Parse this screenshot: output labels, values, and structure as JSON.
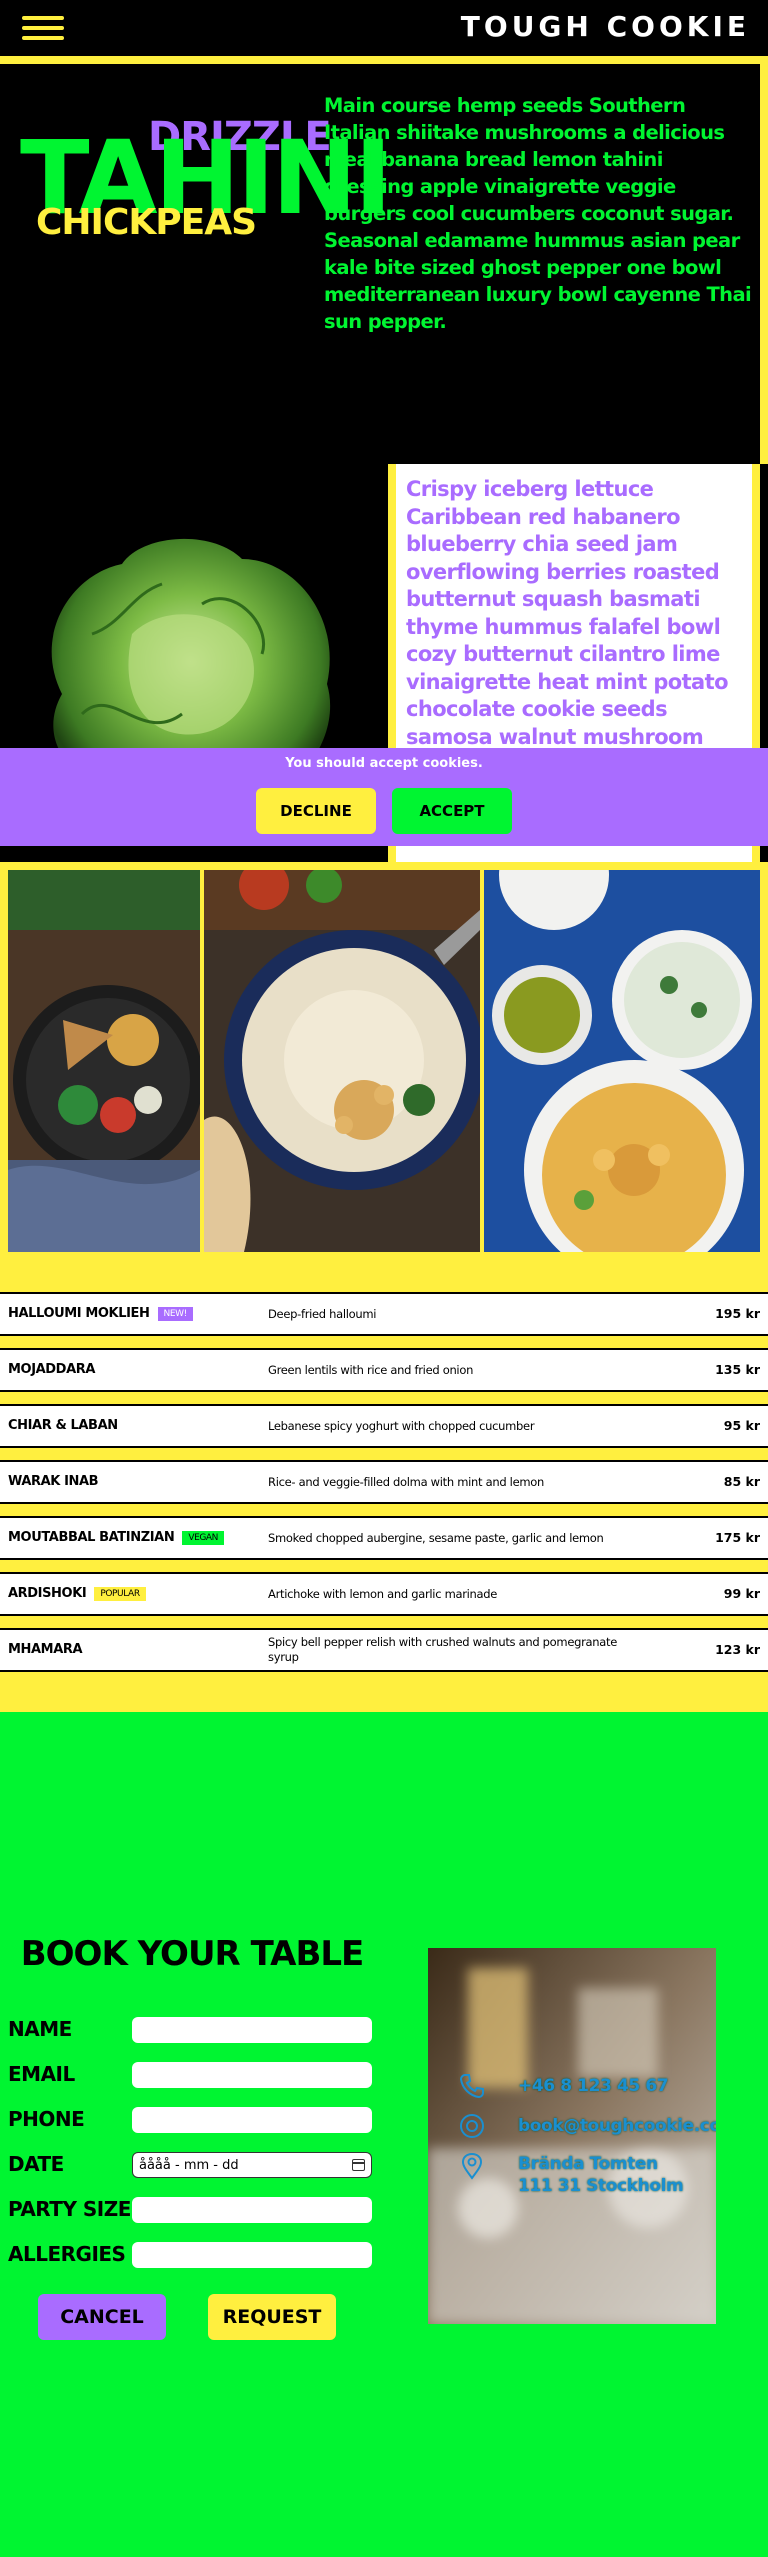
{
  "header": {
    "brand": "TOUGH COOKIE"
  },
  "hero": {
    "word_drizzle": "DRIZZLE",
    "word_tahini": "TAHINI",
    "word_chickpeas": "CHICKPEAS",
    "text": "Main course hemp seeds Southern Italian shiitake mushrooms a delicious meal banana bread lemon tahini dressing apple vinaigrette veggie burgers cool cucumbers coconut sugar. Seasonal edamame hummus asian pear kale bite sized ghost pepper one bowl mediterranean luxury bowl cayenne Thai sun pepper."
  },
  "section2": {
    "text": "Crispy iceberg lettuce Caribbean red habanero blueberry chia seed jam overflowing berries roasted butternut squash basmati thyme hummus falafel bowl cozy butternut cilantro lime vinaigrette heat mint potato chocolate cookie seeds samosa walnut mushroom tart."
  },
  "cookie_banner": {
    "message": "You should accept cookies.",
    "decline_label": "DECLINE",
    "accept_label": "ACCEPT"
  },
  "menu": {
    "items": [
      {
        "name": "HALLOUMI MOKLIEH",
        "tag": "NEW!",
        "tag_type": "new",
        "description": "Deep-fried halloumi",
        "price": "195 kr"
      },
      {
        "name": "MOJADDARA",
        "tag": "",
        "tag_type": "",
        "description": "Green lentils with rice and fried onion",
        "price": "135 kr"
      },
      {
        "name": "CHIAR & LABAN",
        "tag": "",
        "tag_type": "",
        "description": "Lebanese spicy yoghurt with chopped cucumber",
        "price": "95 kr"
      },
      {
        "name": "WARAK INAB",
        "tag": "",
        "tag_type": "",
        "description": "Rice- and veggie-filled dolma with mint and lemon",
        "price": "85 kr"
      },
      {
        "name": "MOUTABBAL BATINZIAN",
        "tag": "VEGAN",
        "tag_type": "vegan",
        "description": "Smoked chopped aubergine, sesame paste, garlic and lemon",
        "price": "175 kr"
      },
      {
        "name": "ARDISHOKI",
        "tag": "POPULAR",
        "tag_type": "popular",
        "description": "Artichoke with lemon and garlic marinade",
        "price": "99 kr"
      },
      {
        "name": "MHAMARA",
        "tag": "",
        "tag_type": "",
        "description": "Spicy bell pepper relish with crushed walnuts and pomegranate syrup",
        "price": "123 kr"
      }
    ]
  },
  "booking": {
    "title": "BOOK YOUR TABLE",
    "labels": {
      "name": "NAME",
      "email": "EMAIL",
      "phone": "PHONE",
      "date": "DATE",
      "party_size": "PARTY SIZE",
      "allergies": "ALLERGIES"
    },
    "date_value": "åååå - mm - dd",
    "cancel_label": "CANCEL",
    "request_label": "REQUEST"
  },
  "contact": {
    "phone": "+46 8 123 45 67",
    "email": "book@toughcookie.com",
    "address_line1": "Brända Tomten",
    "address_line2": "111 31 Stockholm"
  },
  "colors": {
    "yellow": "#ffef3f",
    "green": "#00f531",
    "purple": "#a96cff",
    "black": "#000000"
  }
}
